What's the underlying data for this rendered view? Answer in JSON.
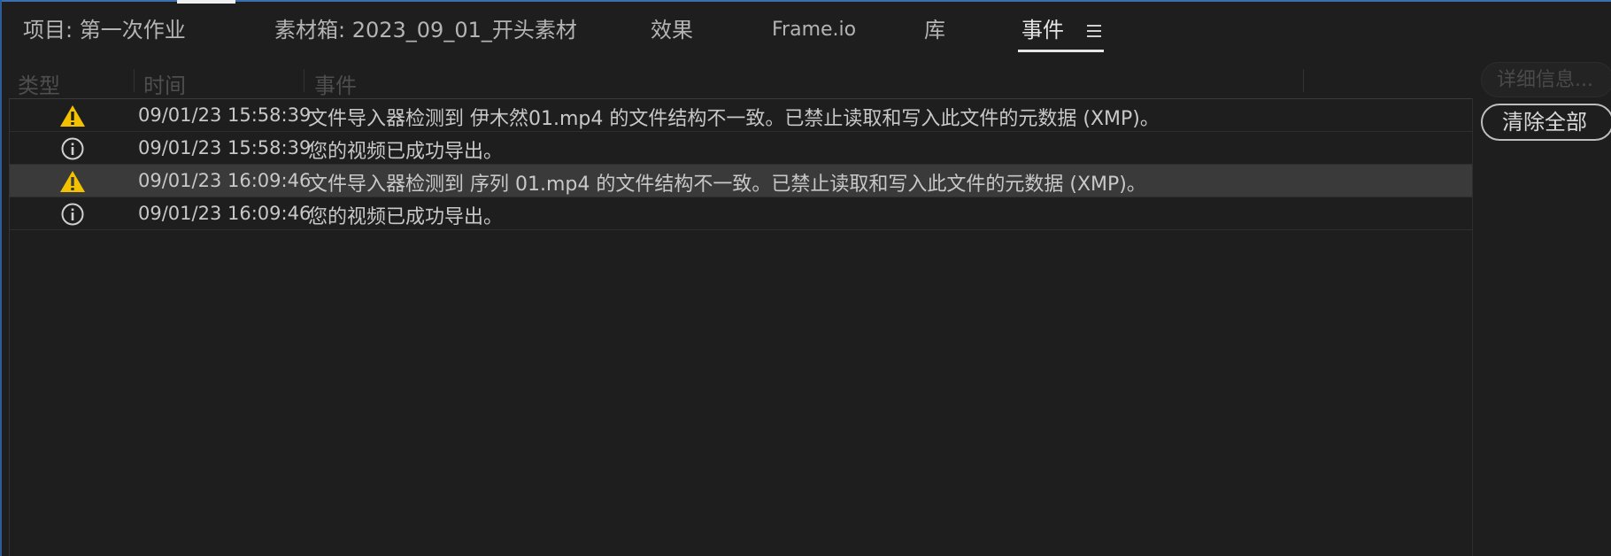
{
  "tabs": [
    {
      "label": "项目: 第一次作业"
    },
    {
      "label": "素材箱: 2023_09_01_开头素材"
    },
    {
      "label": "效果"
    },
    {
      "label": "Frame.io"
    },
    {
      "label": "库"
    },
    {
      "label": "事件"
    }
  ],
  "columns": {
    "type": "类型",
    "time": "时间",
    "event": "事件"
  },
  "events": [
    {
      "icon": "warning-icon",
      "time": "09/01/23 15:58:39",
      "message": "文件导入器检测到 伊木然01.mp4 的文件结构不一致。已禁止读取和写入此文件的元数据 (XMP)。"
    },
    {
      "icon": "info-icon",
      "time": "09/01/23 15:58:39",
      "message": "您的视频已成功导出。"
    },
    {
      "icon": "warning-icon",
      "time": "09/01/23 16:09:46",
      "message": "文件导入器检测到 序列 01.mp4 的文件结构不一致。已禁止读取和写入此文件的元数据 (XMP)。"
    },
    {
      "icon": "info-icon",
      "time": "09/01/23 16:09:46",
      "message": "您的视频已成功导出。"
    }
  ],
  "buttons": {
    "details": "详细信息...",
    "clear_all": "清除全部"
  },
  "colors": {
    "warning": "#f2c200",
    "accent": "#3a6fb0"
  }
}
